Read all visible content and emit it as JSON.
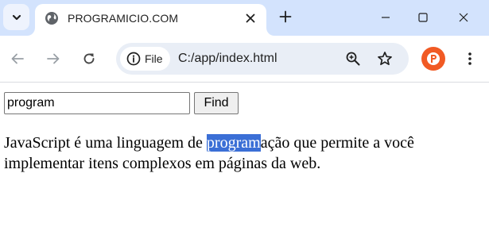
{
  "browser": {
    "tab": {
      "title": "PROGRAMICIO.COM"
    },
    "site_chip": {
      "label": "File"
    },
    "url": "C:/app/index.html",
    "icons": {
      "tab_search": "chevron-down-icon",
      "favicon": "globe-icon",
      "tab_close": "close-icon",
      "new_tab": "plus-icon",
      "minimize": "minimize-icon",
      "maximize": "maximize-icon",
      "close": "close-icon",
      "back": "arrow-left-icon",
      "forward": "arrow-right-icon",
      "reload": "reload-icon",
      "info": "info-icon",
      "zoom": "zoom-icon",
      "bookmark": "star-icon",
      "profile": "profile-avatar",
      "menu": "kebab-menu-icon"
    },
    "colors": {
      "tabstrip": "#d3e3fd",
      "omnibox": "#e9eef6",
      "profile": "#f15a24"
    }
  },
  "page": {
    "search": {
      "value": "program"
    },
    "find_button": {
      "label": "Find"
    },
    "paragraph": {
      "before": "JavaScript é uma linguagem de ",
      "highlight": "program",
      "after": "ação que permite a você implementar itens complexos em páginas da web."
    },
    "colors": {
      "highlight": "#3b6fd6"
    }
  }
}
